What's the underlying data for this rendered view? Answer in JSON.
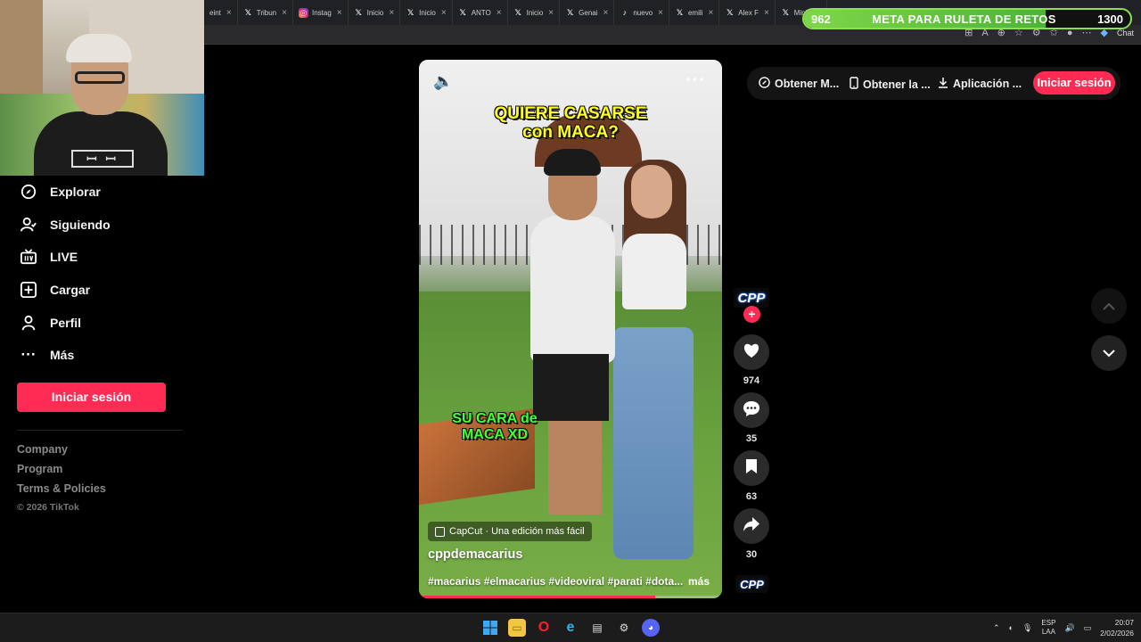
{
  "browser": {
    "tabs": [
      {
        "label": "eint",
        "icon": ""
      },
      {
        "label": "Tribun",
        "icon": "x-icon"
      },
      {
        "label": "Instag",
        "icon": "instagram-icon"
      },
      {
        "label": "Inicio",
        "icon": "x-icon"
      },
      {
        "label": "Inicio",
        "icon": "x-icon"
      },
      {
        "label": "ANTO",
        "icon": "x-icon"
      },
      {
        "label": "Inicio",
        "icon": "x-icon"
      },
      {
        "label": "Genai",
        "icon": "x-icon"
      },
      {
        "label": "nuevo",
        "icon": "tiktok-icon"
      },
      {
        "label": "emili",
        "icon": "x-icon"
      },
      {
        "label": "Alex F",
        "icon": "x-icon"
      },
      {
        "label": "Minis",
        "icon": "x-icon"
      }
    ],
    "chat_label": "Chat"
  },
  "goal": {
    "current": "962",
    "title": "META PARA RULETA DE RETOS",
    "target": "1300",
    "progress": 0.74
  },
  "sidebar": {
    "items": [
      {
        "label": "Explorar",
        "icon": "compass-icon"
      },
      {
        "label": "Siguiendo",
        "icon": "user-following-icon"
      },
      {
        "label": "LIVE",
        "icon": "live-tv-icon"
      },
      {
        "label": "Cargar",
        "icon": "upload-plus-icon"
      },
      {
        "label": "Perfil",
        "icon": "profile-icon"
      },
      {
        "label": "Más",
        "icon": "more-dots-icon"
      }
    ],
    "login_label": "Iniciar sesión",
    "footer_links": [
      "Company",
      "Program",
      "Terms & Policies"
    ],
    "copyright": "© 2026 TikTok"
  },
  "video": {
    "caption_top": "QUIERE CASARSE con MACA?",
    "caption_bottom": "SU CARA de MACA XD",
    "capcut_label": "CapCut · Una edición más fácil",
    "author": "cppdemacarius",
    "tags": "#macarius #elmacarius #videoviral #parati #dota...",
    "more": "más",
    "progress": 0.78
  },
  "actions": {
    "avatar_text": "CPP",
    "likes": "974",
    "comments": "35",
    "saves": "63",
    "shares": "30"
  },
  "top_bar": {
    "get_coins": "Obtener M...",
    "get_app": "Obtener la ...",
    "download_app": "Aplicación ...",
    "login": "Iniciar sesión"
  },
  "taskbar": {
    "lang_top": "ESP",
    "lang_bottom": "LAA",
    "time": "20:07",
    "date": "2/02/2026"
  },
  "colors": {
    "accent": "#fe2c55",
    "goal_green": "#7fd64a"
  }
}
